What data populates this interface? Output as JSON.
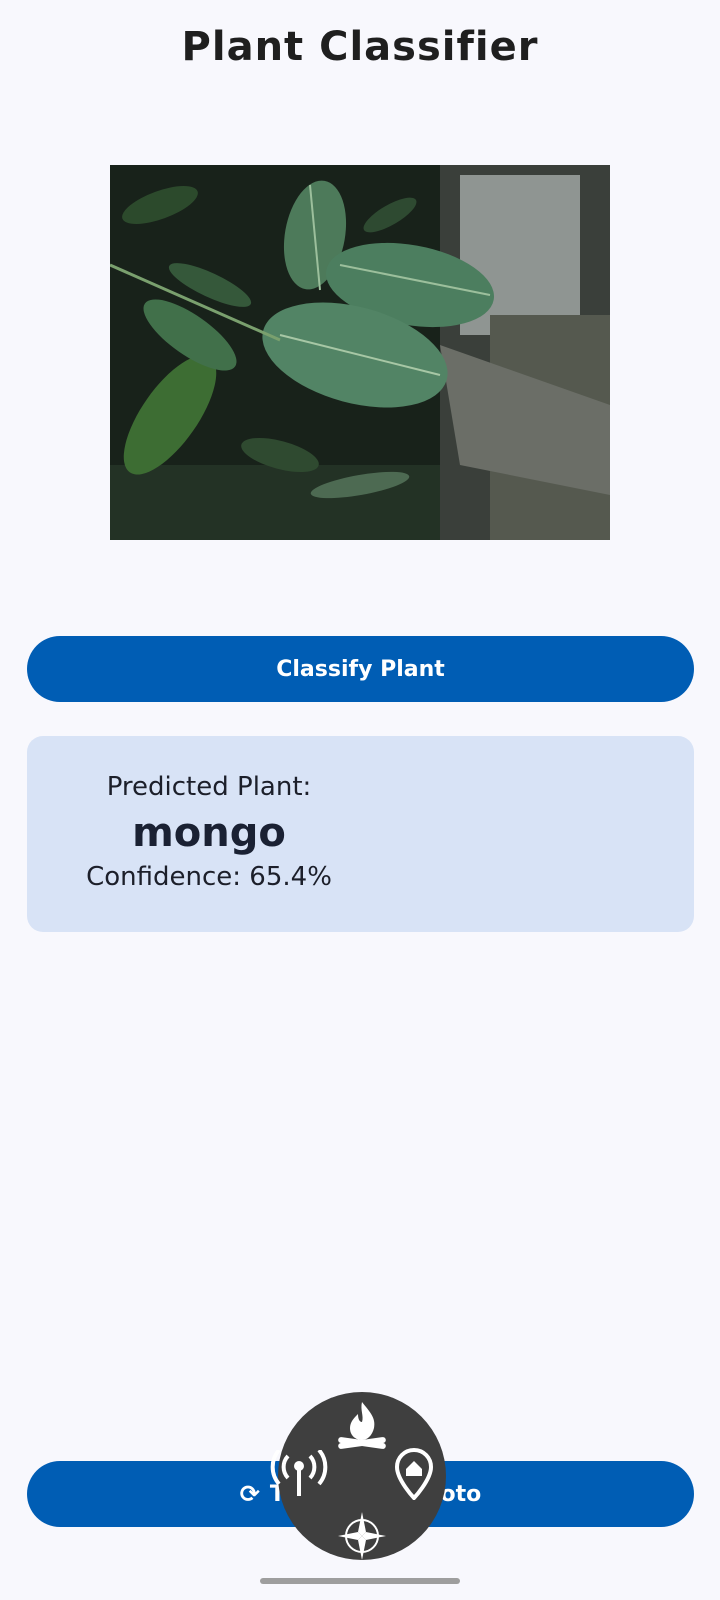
{
  "app": {
    "title": "Plant Classifier"
  },
  "image": {
    "description_icon": "plant-photo"
  },
  "buttons": {
    "classify_label": "Classify Plant",
    "retake_label_visible_left": "T",
    "retake_label_visible_right": "hoto",
    "retake_icon": "refresh-icon"
  },
  "result": {
    "label": "Predicted Plant:",
    "value": "mongo",
    "confidence": "Confidence: 65.4%"
  },
  "overlay_menu": {
    "icons": [
      "fire-icon",
      "broadcast-icon",
      "home-pin-icon",
      "compass-icon"
    ]
  },
  "colors": {
    "background": "#f8f8fd",
    "primary": "#005db4",
    "card": "#d8e3f6",
    "overlay": "#3f3f3f"
  }
}
